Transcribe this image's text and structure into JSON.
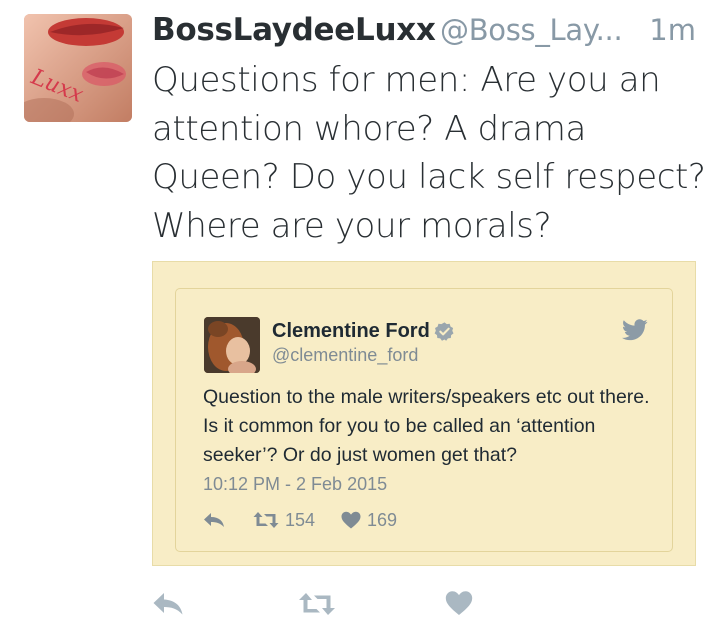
{
  "tweet": {
    "display_name": "BossLaydeeLuxx",
    "handle": "@Boss_Lay...",
    "timestamp": "1m",
    "text": "Questions for men: Are you an attention whore? A drama Queen? Do you lack self respect? Where are your morals?",
    "avatar_icon": "lips-avatar-image"
  },
  "quoted_tweet": {
    "display_name": "Clementine Ford",
    "handle": "@clementine_ford",
    "verified": true,
    "text": "Question to the male writers/speakers etc out there. Is it common for you to be called an ‘attention seeker’? Or do just women get that?",
    "time": "10:12 PM - 2 Feb 2015",
    "retweet_count": "154",
    "like_count": "169"
  },
  "colors": {
    "quote_background": "#f8edc6",
    "quote_border": "#e3d49b",
    "muted_text": "#8899a6",
    "action_icon": "#aab8c2",
    "verified_badge": "#9aa6ad"
  }
}
